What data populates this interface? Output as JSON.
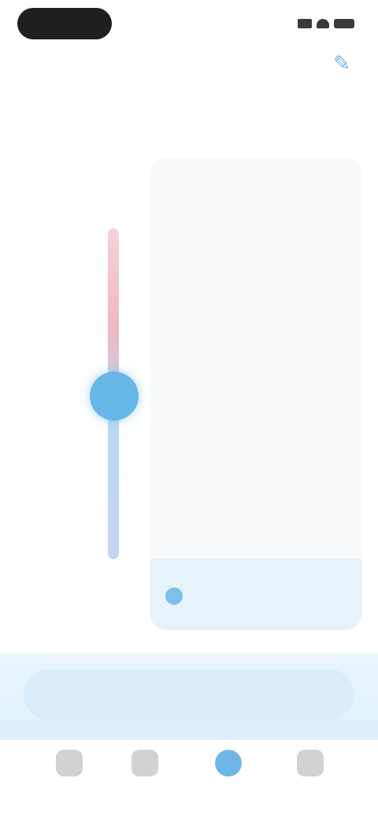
{
  "status_bar": {
    "time": ""
  },
  "header": {
    "title": "",
    "action_icon": "edit-icon"
  },
  "subtitle_link": "",
  "scale": {
    "labels": [
      "",
      "",
      "",
      "",
      "",
      "",
      ""
    ],
    "active_index": 3
  },
  "slider": {
    "level": 0.5
  },
  "card": {
    "caption": "",
    "value": "",
    "unit": "",
    "row1_caption": "",
    "row1_value": "",
    "row2_caption": "",
    "row2_value": "",
    "left_small": "",
    "right_small": "",
    "tip": ""
  },
  "bottom_button": "",
  "tabs": [
    {
      "label": "",
      "icon": "home-icon"
    },
    {
      "label": "",
      "icon": "list-icon"
    },
    {
      "label": "",
      "icon": "water-icon"
    },
    {
      "label": "",
      "icon": "profile-icon"
    }
  ],
  "colors": {
    "accent": "#66b6e8",
    "orange": "#f2a540"
  }
}
